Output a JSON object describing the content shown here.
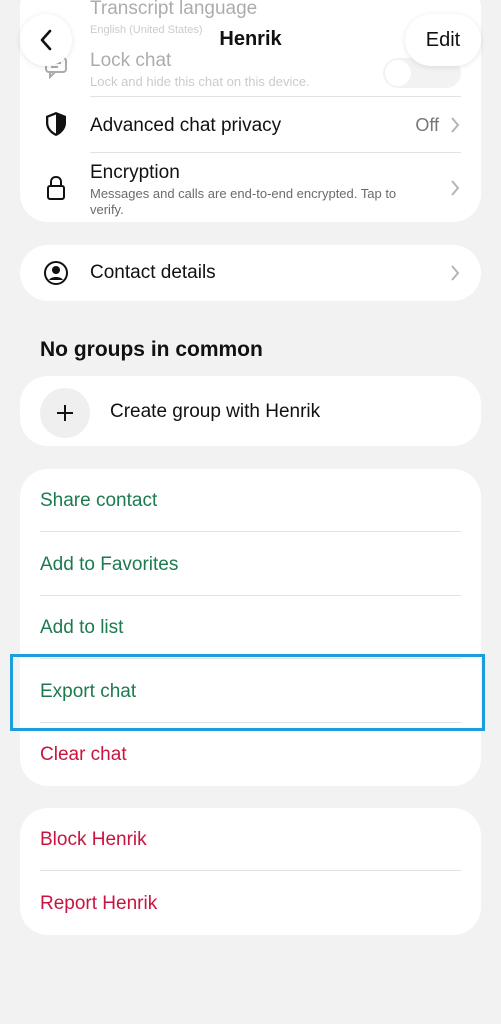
{
  "header": {
    "title": "Henrik",
    "edit_label": "Edit"
  },
  "privacy_card": {
    "transcript_language": {
      "label": "Transcript language",
      "sub": "English (United States)"
    },
    "lock_chat": {
      "label": "Lock chat",
      "sub": "Lock and hide this chat on this device.",
      "enabled": false
    },
    "advanced_privacy": {
      "label": "Advanced chat privacy",
      "value": "Off"
    },
    "encryption": {
      "label": "Encryption",
      "sub": "Messages and calls are end-to-end encrypted. Tap to verify."
    }
  },
  "contact_details": {
    "label": "Contact details"
  },
  "groups": {
    "header": "No groups in common",
    "create_label": "Create group with Henrik"
  },
  "actions": {
    "share": "Share contact",
    "favorites": "Add to Favorites",
    "list": "Add to list",
    "export": "Export chat",
    "clear": "Clear chat"
  },
  "danger": {
    "block": "Block Henrik",
    "report": "Report Henrik"
  },
  "colors": {
    "accent_green": "#1d7a4f",
    "danger_red": "#c8143f",
    "highlight": "#1a9ee0"
  },
  "icons": {
    "back": "chevron-left-icon",
    "lock_chat": "chat-lock-icon",
    "privacy": "shield-icon",
    "encryption": "lock-icon",
    "contact": "person-circle-icon",
    "create_group": "plus-icon",
    "chevron": "chevron-right-icon"
  }
}
